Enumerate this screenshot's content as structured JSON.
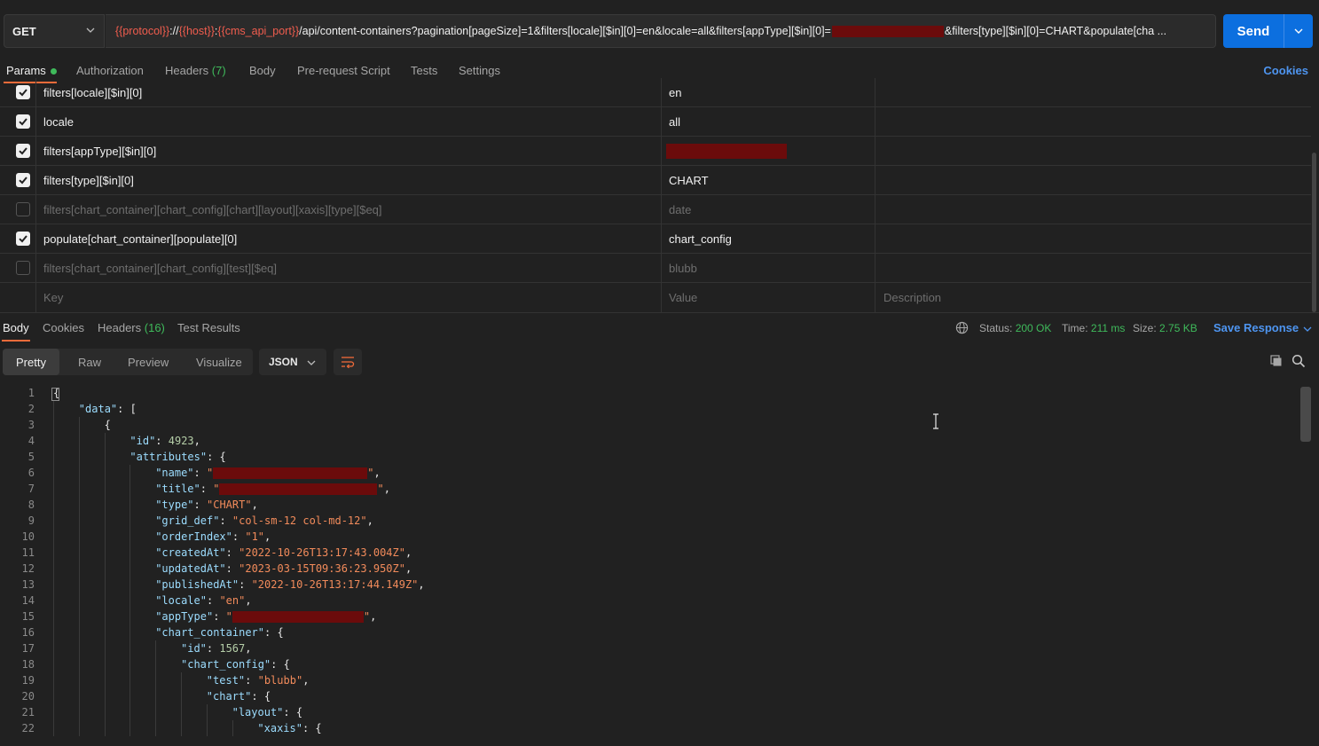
{
  "request": {
    "method": "GET",
    "url_parts": [
      {
        "t": "{{protocol}}",
        "var": true
      },
      {
        "t": "://",
        "var": false
      },
      {
        "t": "{{host}}",
        "var": true
      },
      {
        "t": ":",
        "var": false
      },
      {
        "t": "{{cms_api_port}}",
        "var": true
      },
      {
        "t": "/api/content-containers?pagination[pageSize]=1&filters[locale][$in][0]=en&locale=all&filters[appType][$in][0]=",
        "var": false
      }
    ],
    "url_tail": "&filters[type][$in][0]=CHART&populate[cha ...",
    "send_label": "Send"
  },
  "req_tabs": {
    "params": "Params",
    "authorization": "Authorization",
    "headers": "Headers",
    "headers_count": "(7)",
    "body": "Body",
    "prerequest": "Pre-request Script",
    "tests": "Tests",
    "settings": "Settings",
    "cookies": "Cookies"
  },
  "params": [
    {
      "key": "filters[locale][$in][0]",
      "value": "en",
      "checked": true
    },
    {
      "key": "locale",
      "value": "all",
      "checked": true
    },
    {
      "key": "filters[appType][$in][0]",
      "value": "",
      "redacted": true,
      "checked": true
    },
    {
      "key": "filters[type][$in][0]",
      "value": "CHART",
      "checked": true
    },
    {
      "key": "filters[chart_container][chart_config][chart][layout][xaxis][type][$eq]",
      "value": "date",
      "checked": false
    },
    {
      "key": "populate[chart_container][populate][0]",
      "value": "chart_config",
      "checked": true
    },
    {
      "key": "filters[chart_container][chart_config][test][$eq]",
      "value": "blubb",
      "checked": false
    }
  ],
  "params_placeholder": {
    "key": "Key",
    "value": "Value",
    "description": "Description"
  },
  "resp_tabs": {
    "body": "Body",
    "cookies": "Cookies",
    "headers": "Headers",
    "headers_count": "(16)",
    "test_results": "Test Results"
  },
  "status": {
    "status_label": "Status:",
    "status_value": "200 OK",
    "time_label": "Time:",
    "time_value": "211 ms",
    "size_label": "Size:",
    "size_value": "2.75 KB",
    "save_label": "Save Response"
  },
  "view": {
    "pretty": "Pretty",
    "raw": "Raw",
    "preview": "Preview",
    "visualize": "Visualize",
    "format": "JSON"
  },
  "code_lines": [
    {
      "n": "1",
      "indent": 0,
      "parts": [
        {
          "c": "p",
          "t": "{"
        }
      ]
    },
    {
      "n": "2",
      "indent": 1,
      "parts": [
        {
          "c": "k",
          "t": "\"data\""
        },
        {
          "c": "p",
          "t": ": ["
        }
      ]
    },
    {
      "n": "3",
      "indent": 2,
      "parts": [
        {
          "c": "p",
          "t": "{"
        }
      ]
    },
    {
      "n": "4",
      "indent": 3,
      "parts": [
        {
          "c": "k",
          "t": "\"id\""
        },
        {
          "c": "p",
          "t": ": "
        },
        {
          "c": "n",
          "t": "4923"
        },
        {
          "c": "p",
          "t": ","
        }
      ]
    },
    {
      "n": "5",
      "indent": 3,
      "parts": [
        {
          "c": "k",
          "t": "\"attributes\""
        },
        {
          "c": "p",
          "t": ": {"
        }
      ]
    },
    {
      "n": "6",
      "indent": 4,
      "parts": [
        {
          "c": "k",
          "t": "\"name\""
        },
        {
          "c": "p",
          "t": ": "
        },
        {
          "c": "s",
          "t": "\""
        },
        {
          "c": "r",
          "t": "174"
        },
        {
          "c": "s",
          "t": "\""
        },
        {
          "c": "p",
          "t": ","
        }
      ]
    },
    {
      "n": "7",
      "indent": 4,
      "parts": [
        {
          "c": "k",
          "t": "\"title\""
        },
        {
          "c": "p",
          "t": ": "
        },
        {
          "c": "s",
          "t": "\""
        },
        {
          "c": "r",
          "t": "178"
        },
        {
          "c": "s",
          "t": "\""
        },
        {
          "c": "p",
          "t": ","
        }
      ]
    },
    {
      "n": "8",
      "indent": 4,
      "parts": [
        {
          "c": "k",
          "t": "\"type\""
        },
        {
          "c": "p",
          "t": ": "
        },
        {
          "c": "s",
          "t": "\"CHART\""
        },
        {
          "c": "p",
          "t": ","
        }
      ]
    },
    {
      "n": "9",
      "indent": 4,
      "parts": [
        {
          "c": "k",
          "t": "\"grid_def\""
        },
        {
          "c": "p",
          "t": ": "
        },
        {
          "c": "s",
          "t": "\"col-sm-12 col-md-12\""
        },
        {
          "c": "p",
          "t": ","
        }
      ]
    },
    {
      "n": "10",
      "indent": 4,
      "parts": [
        {
          "c": "k",
          "t": "\"orderIndex\""
        },
        {
          "c": "p",
          "t": ": "
        },
        {
          "c": "s",
          "t": "\"1\""
        },
        {
          "c": "p",
          "t": ","
        }
      ]
    },
    {
      "n": "11",
      "indent": 4,
      "parts": [
        {
          "c": "k",
          "t": "\"createdAt\""
        },
        {
          "c": "p",
          "t": ": "
        },
        {
          "c": "s",
          "t": "\"2022-10-26T13:17:43.004Z\""
        },
        {
          "c": "p",
          "t": ","
        }
      ]
    },
    {
      "n": "12",
      "indent": 4,
      "parts": [
        {
          "c": "k",
          "t": "\"updatedAt\""
        },
        {
          "c": "p",
          "t": ": "
        },
        {
          "c": "s",
          "t": "\"2023-03-15T09:36:23.950Z\""
        },
        {
          "c": "p",
          "t": ","
        }
      ]
    },
    {
      "n": "13",
      "indent": 4,
      "parts": [
        {
          "c": "k",
          "t": "\"publishedAt\""
        },
        {
          "c": "p",
          "t": ": "
        },
        {
          "c": "s",
          "t": "\"2022-10-26T13:17:44.149Z\""
        },
        {
          "c": "p",
          "t": ","
        }
      ]
    },
    {
      "n": "14",
      "indent": 4,
      "parts": [
        {
          "c": "k",
          "t": "\"locale\""
        },
        {
          "c": "p",
          "t": ": "
        },
        {
          "c": "s",
          "t": "\"en\""
        },
        {
          "c": "p",
          "t": ","
        }
      ]
    },
    {
      "n": "15",
      "indent": 4,
      "parts": [
        {
          "c": "k",
          "t": "\"appType\""
        },
        {
          "c": "p",
          "t": ": "
        },
        {
          "c": "s",
          "t": "\""
        },
        {
          "c": "r",
          "t": "148"
        },
        {
          "c": "s",
          "t": "\""
        },
        {
          "c": "p",
          "t": ","
        }
      ]
    },
    {
      "n": "16",
      "indent": 4,
      "parts": [
        {
          "c": "k",
          "t": "\"chart_container\""
        },
        {
          "c": "p",
          "t": ": {"
        }
      ]
    },
    {
      "n": "17",
      "indent": 5,
      "parts": [
        {
          "c": "k",
          "t": "\"id\""
        },
        {
          "c": "p",
          "t": ": "
        },
        {
          "c": "n",
          "t": "1567"
        },
        {
          "c": "p",
          "t": ","
        }
      ]
    },
    {
      "n": "18",
      "indent": 5,
      "parts": [
        {
          "c": "k",
          "t": "\"chart_config\""
        },
        {
          "c": "p",
          "t": ": {"
        }
      ]
    },
    {
      "n": "19",
      "indent": 6,
      "parts": [
        {
          "c": "k",
          "t": "\"test\""
        },
        {
          "c": "p",
          "t": ": "
        },
        {
          "c": "s",
          "t": "\"blubb\""
        },
        {
          "c": "p",
          "t": ","
        }
      ]
    },
    {
      "n": "20",
      "indent": 6,
      "parts": [
        {
          "c": "k",
          "t": "\"chart\""
        },
        {
          "c": "p",
          "t": ": {"
        }
      ]
    },
    {
      "n": "21",
      "indent": 7,
      "parts": [
        {
          "c": "k",
          "t": "\"layout\""
        },
        {
          "c": "p",
          "t": ": {"
        }
      ]
    },
    {
      "n": "22",
      "indent": 8,
      "parts": [
        {
          "c": "k",
          "t": "\"xaxis\""
        },
        {
          "c": "p",
          "t": ": {"
        }
      ]
    }
  ],
  "colors": {
    "accent": "#f26b3a",
    "send": "#0c6fdf",
    "link": "#4e95f0",
    "ok": "#3fba5b",
    "redact": "#6b0b0b"
  },
  "icons": {
    "wrap": "wrap-lines-icon",
    "copy": "copy-icon",
    "search": "search-icon",
    "globe": "globe-icon"
  }
}
